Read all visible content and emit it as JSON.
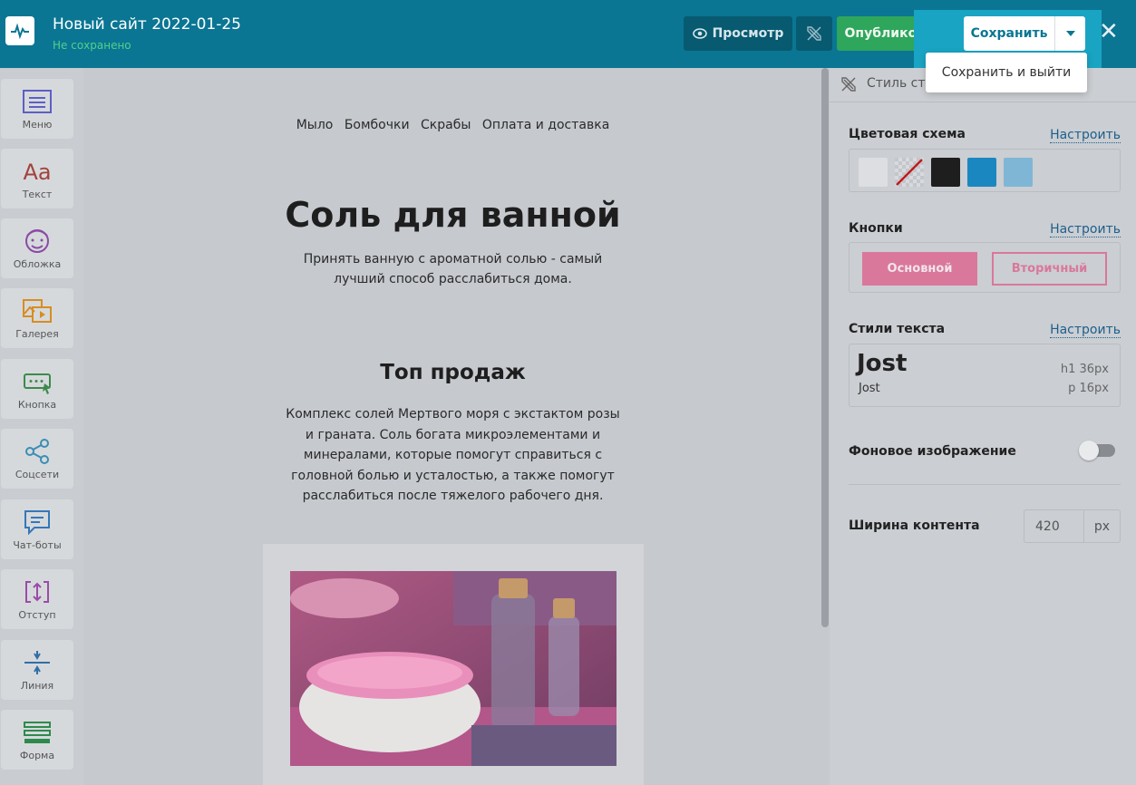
{
  "header": {
    "site_title": "Новый сайт 2022-01-25",
    "save_status": "Не сохранено",
    "preview_label": "Просмотр",
    "publish_label": "Опубликовать",
    "save_label": "Сохранить",
    "dropdown_item": "Сохранить и выйти"
  },
  "sidebar": {
    "items": [
      {
        "label": "Меню",
        "icon": "menu-icon"
      },
      {
        "label": "Текст",
        "icon": "text-icon"
      },
      {
        "label": "Обложка",
        "icon": "cover-icon"
      },
      {
        "label": "Галерея",
        "icon": "gallery-icon"
      },
      {
        "label": "Кнопка",
        "icon": "button-icon"
      },
      {
        "label": "Соцсети",
        "icon": "share-icon"
      },
      {
        "label": "Чат-боты",
        "icon": "chat-icon"
      },
      {
        "label": "Отступ",
        "icon": "spacing-icon"
      },
      {
        "label": "Линия",
        "icon": "line-icon"
      },
      {
        "label": "Форма",
        "icon": "form-icon"
      }
    ]
  },
  "canvas": {
    "nav": [
      "Мыло",
      "Бомбочки",
      "Скрабы",
      "Оплата и доставка"
    ],
    "title": "Соль для ванной",
    "lead": "Принять ванную с ароматной солью - самый лучший способ расслабиться дома.",
    "section_title": "Топ продаж",
    "section_text": "Комплекс солей Мертвого моря с экстактом розы и граната. Соль богата микроэлементами и минералами, которые помогут справиться с головной болью и усталостью, а также помогут расслабиться после тяжелого рабочего дня."
  },
  "panel": {
    "header": "Стиль стр",
    "color_scheme_title": "Цветовая схема",
    "configure": "Настроить",
    "swatches": [
      "#dcdee1",
      "transparent",
      "#1e1e1e",
      "#1b87c1",
      "#7fb6d6"
    ],
    "buttons_title": "Кнопки",
    "primary_label": "Основной",
    "secondary_label": "Вторичный",
    "text_styles_title": "Стили текста",
    "font_heading": "Jost",
    "font_body": "Jost",
    "h1_spec": "h1   36px",
    "p_spec": "p   16px",
    "bg_image_label": "Фоновое изображение",
    "content_width_label": "Ширина контента",
    "content_width_value": "420",
    "content_width_unit": "px"
  },
  "colors": {
    "topbar": "#0a7693",
    "publish": "#2ea65b",
    "accent_pink": "#d9789a"
  }
}
